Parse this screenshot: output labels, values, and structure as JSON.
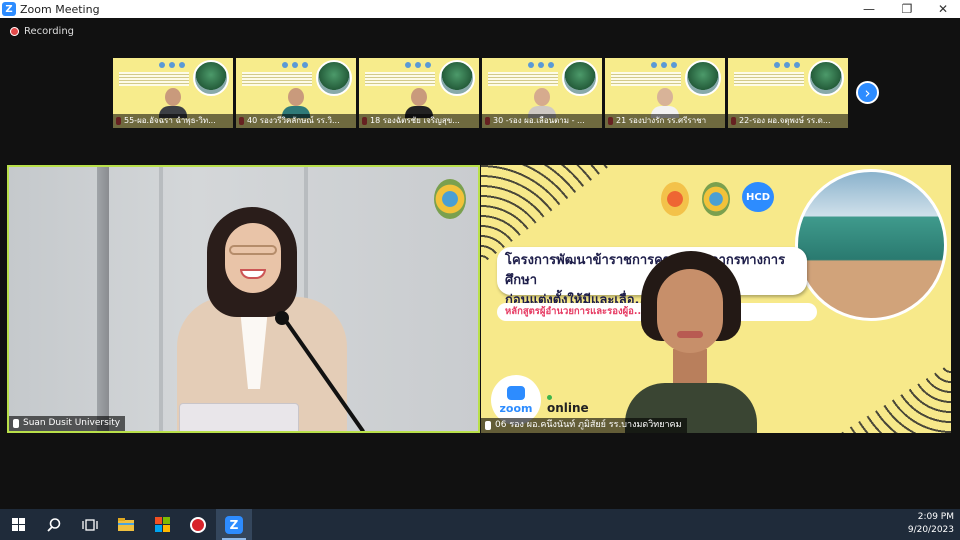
{
  "window": {
    "title": "Zoom Meeting",
    "app_icon": "zoom-icon",
    "controls": [
      "minimize",
      "maximize",
      "close"
    ]
  },
  "recording": {
    "label": "Recording",
    "indicator_color": "#e34a4a"
  },
  "gallery": {
    "thumbnails": [
      {
        "name": "55-ผอ.อัจฉรา ฉำพุธ-วิท..."
      },
      {
        "name": "40 รองวรีวิคลักษณ์ รร.วิ..."
      },
      {
        "name": "18 รองฉัตรชัย เจริญสุข..."
      },
      {
        "name": "30 -รอง ผอ.เลือนตาม - ..."
      },
      {
        "name": "21 รองปางรัก รร.ศรีราชา"
      },
      {
        "name": "22-รอง ผอ.จตุพงษ์ รร.ด..."
      }
    ],
    "next_icon": "chevron-right-icon"
  },
  "main": {
    "left_tile": {
      "name": "Suan Dusit University",
      "active_speaker_color": "#b9e04a"
    },
    "right_tile": {
      "name": "06 รอง ผอ.คนึงนันท์ ภูมิสัยย์ รร.บางมดวิทยาคม",
      "slide": {
        "title_line1": "โครงการพัฒนาข้าราชการครู  ...  บุคลากรทางการศึกษา",
        "title_line2": "ก่อนแต่งตั้งให้มีและเลื่อ...",
        "subtitle": "หลักสูตรผู้อำนวยการและรองผู้อ...           ...ษา ระยะที่ 133",
        "badge_logo": "HCD",
        "zoom_label": "zoom",
        "online_label": "online"
      }
    }
  },
  "taskbar": {
    "items": [
      {
        "name": "windows-start-icon"
      },
      {
        "name": "search-icon"
      },
      {
        "name": "task-view-icon"
      },
      {
        "name": "file-explorer-icon"
      },
      {
        "name": "store-icon"
      },
      {
        "name": "app-red-icon"
      },
      {
        "name": "zoom-taskbar-icon",
        "active": true
      }
    ],
    "time": "2:09 PM",
    "date": "9/20/2023"
  }
}
